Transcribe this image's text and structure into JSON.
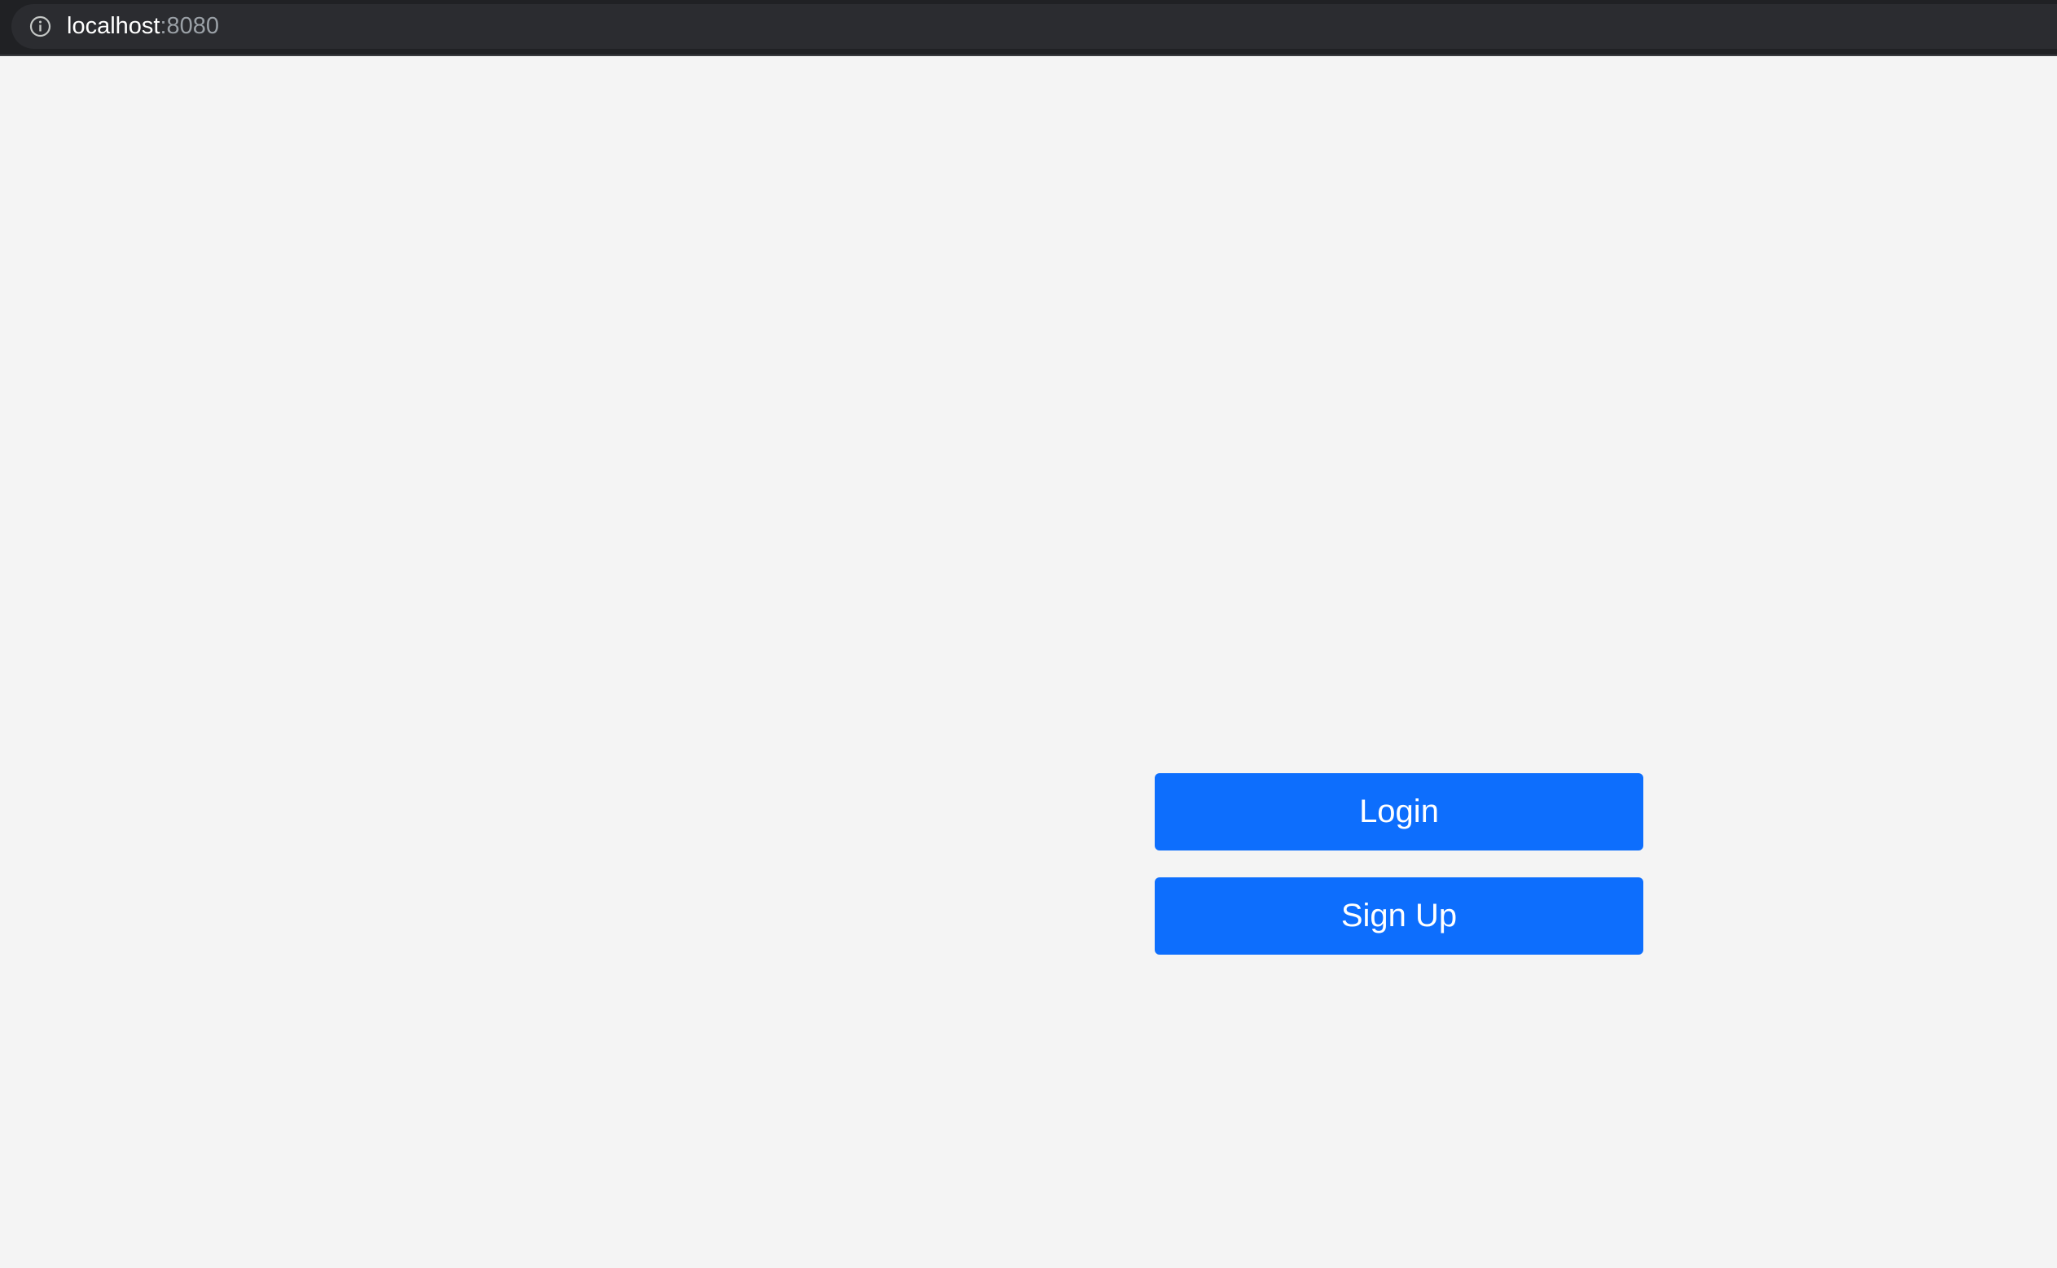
{
  "browser": {
    "address_host": "localhost",
    "address_port": ":8080",
    "icon": "info-icon"
  },
  "main": {
    "login_label": "Login",
    "signup_label": "Sign Up"
  },
  "colors": {
    "page_background": "#f4f4f4",
    "button_primary": "#0d6efd",
    "browser_bar": "#202124"
  }
}
